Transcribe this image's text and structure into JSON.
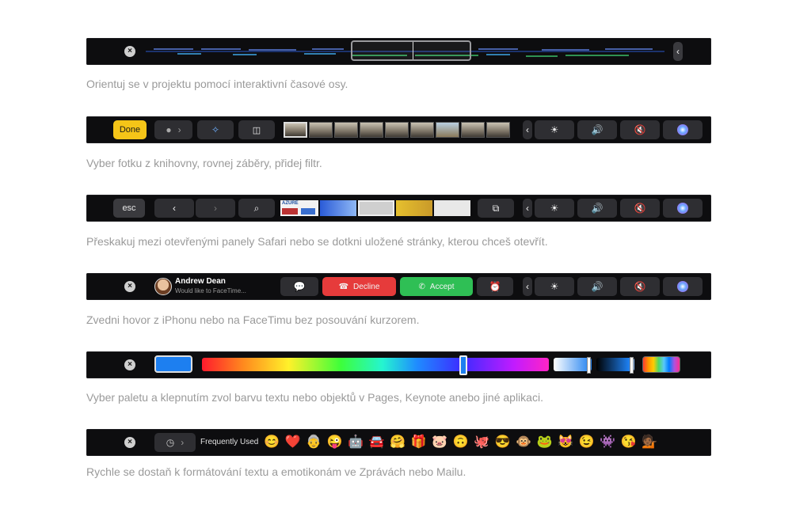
{
  "captions": {
    "timeline": "Orientuj se v projektu pomocí interaktivní časové osy.",
    "photos": "Vyber fotku z knihovny, rovnej záběry, přidej filtr.",
    "safari": "Přeskakuj mezi otevřenými panely Safari nebo se dotkni uložené stránky, kterou chceš otevřít.",
    "facetime": "Zvedni hovor z iPhonu nebo na FaceTimu bez posouvání kurzorem.",
    "colors": "Vyber paletu a klepnutím zvol barvu textu nebo objektů v Pages, Keynote anebo jiné aplikaci.",
    "emoji": "Rychle se dostaň k formátování textu a emotikonám ve Zprávách nebo Mailu."
  },
  "photos_bar": {
    "done_label": "Done"
  },
  "safari_bar": {
    "esc_label": "esc",
    "tab_label": "AZURE"
  },
  "facetime_bar": {
    "caller_name": "Andrew Dean",
    "caller_subtitle": "Would like to FaceTime...",
    "decline_label": "Decline",
    "accept_label": "Accept"
  },
  "emoji_bar": {
    "category_label": "Frequently Used",
    "emojis": [
      "😊",
      "❤️",
      "👵",
      "😜",
      "🤖",
      "🚘",
      "🤗",
      "🎁",
      "🐷",
      "🙃",
      "🐙",
      "😎",
      "🐵",
      "🐸",
      "😻",
      "😉",
      "👾",
      "😘",
      "💁🏾"
    ]
  },
  "control_strip": {
    "icons": [
      "chevron-left-icon",
      "brightness-icon",
      "volume-icon",
      "mute-icon",
      "siri-icon"
    ]
  },
  "colors": {
    "accent_blue": "#1d7ff0",
    "decline_red": "#e63b3b",
    "accept_green": "#2fbf55",
    "done_yellow": "#f5c518"
  }
}
